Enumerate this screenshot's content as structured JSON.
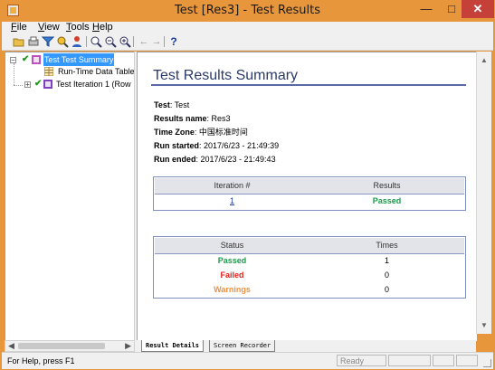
{
  "window": {
    "title": "Test [Res3] - Test Results",
    "minimize": "—",
    "maximize": "□",
    "close": "✕"
  },
  "menu": [
    {
      "label": "File",
      "hotkey": "F",
      "rest": "ile"
    },
    {
      "label": "View",
      "hotkey": "V",
      "rest": "iew"
    },
    {
      "label": "Tools",
      "hotkey": "T",
      "rest": "ools"
    },
    {
      "label": "Help",
      "hotkey": "H",
      "rest": "elp"
    }
  ],
  "toolbar": {
    "icons": [
      "open-icon",
      "print-icon",
      "filter-icon",
      "find-icon",
      "person-icon",
      "zoom-in-icon",
      "zoom-out-icon",
      "zoom-icon",
      "back-arrow-icon",
      "forward-arrow-icon",
      "help-icon"
    ],
    "back_glyph": "←",
    "forward_glyph": "→",
    "help_glyph": "?"
  },
  "tree": {
    "expand_minus": "−",
    "expand_plus": "+",
    "check_glyph": "✔",
    "items": [
      {
        "label": "Test Test Summary",
        "selected": true
      },
      {
        "label": "Run-Time Data Table"
      },
      {
        "label": "Test Iteration 1 (Row"
      }
    ]
  },
  "hscroll": {
    "left": "◀",
    "right": "▶"
  },
  "vscroll": {
    "up": "▲",
    "down": "▼"
  },
  "summary": {
    "title": "Test Results Summary",
    "test_label": "Test",
    "test_value": ": Test",
    "results_name_label": "Results name",
    "results_name_value": ": Res3",
    "time_zone_label": "Time Zone",
    "time_zone_value": ": 中国标准时间",
    "run_started_label": "Run started",
    "run_started_value": ": 2017/6/23 - 21:49:39",
    "run_ended_label": "Run ended",
    "run_ended_value": ": 2017/6/23 - 21:49:43"
  },
  "iterations_table": {
    "headers": [
      "Iteration #",
      "Results"
    ],
    "rows": [
      {
        "iteration": "1",
        "result": "Passed"
      }
    ]
  },
  "status_table": {
    "headers": [
      "Status",
      "Times"
    ],
    "rows": [
      {
        "status": "Passed",
        "times": "1"
      },
      {
        "status": "Failed",
        "times": "0"
      },
      {
        "status": "Warnings",
        "times": "0"
      }
    ]
  },
  "tabs": [
    {
      "label": "Result Details",
      "active": true
    },
    {
      "label": "Screen Recorder",
      "active": false
    }
  ],
  "status_bar": {
    "help_text": "For Help, press F1",
    "ready": "Ready"
  },
  "colors": {
    "titlebar": "#e8963c",
    "passed": "#1a9a4a",
    "failed": "#e0201a",
    "warnings": "#f09040",
    "heading": "#2b3a6a"
  }
}
